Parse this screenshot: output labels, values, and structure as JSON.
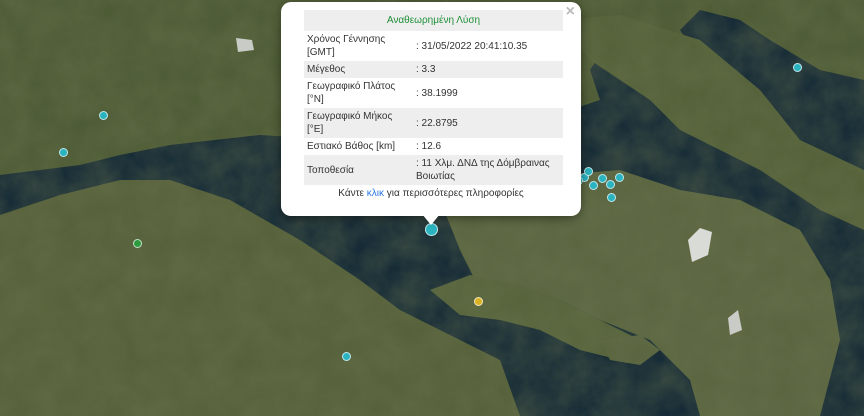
{
  "popup": {
    "title": "Αναθεωρημένη Λύση",
    "rows": [
      {
        "label": "Χρόνος Γέννησης [GMT]",
        "value": ": 31/05/2022 20:41:10.35"
      },
      {
        "label": "Μέγεθος",
        "value": ": 3.3"
      },
      {
        "label": "Γεωγραφικό Πλάτος [°N]",
        "value": ": 38.1999"
      },
      {
        "label": "Γεωγραφικό Μήκος [°E]",
        "value": ": 22.8795"
      },
      {
        "label": "Εστιακό Βάθος [km]",
        "value": ": 12.6"
      },
      {
        "label": "Τοποθεσία",
        "value": ": 11 Χλμ. ΔΝΔ της Δόμβραινας Βοιωτίας"
      }
    ],
    "more_prefix": "Κάντε ",
    "more_link": "κλικ",
    "more_suffix": " για περισσότερες πληροφορίες",
    "close_symbol": "×"
  },
  "colors": {
    "sea": "#0f2535",
    "land": "#4c5a34",
    "marker_cyan": "#2bb3c0",
    "marker_green": "#2e9a3e",
    "marker_yellow": "#d8b224",
    "title_green": "#1f8f38",
    "link_blue": "#2a7ae2"
  }
}
